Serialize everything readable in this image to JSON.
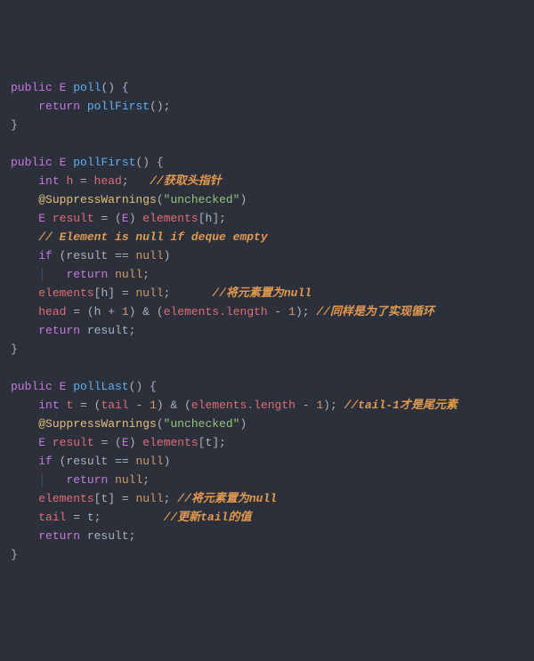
{
  "code": {
    "poll": {
      "kw_public": "public",
      "typ": "E",
      "name": "poll",
      "paren": "() {",
      "ret": "return",
      "call": "pollFirst",
      "after": "();",
      "close": "}"
    },
    "pf": {
      "kw_public": "public",
      "typ": "E",
      "name": "pollFirst",
      "paren": "() {",
      "l1_int": "int",
      "l1_h": "h",
      "l1_eq": " = ",
      "l1_head": "head",
      "l1_semi": ";   ",
      "l1_com": "//获取头指针",
      "l2_ann": "@SuppressWarnings",
      "l2_paren": "(",
      "l2_str": "\"unchecked\"",
      "l2_close": ")",
      "l3_E": "E",
      "l3_res": "result",
      "l3_eq": " = (",
      "l3_E2": "E",
      "l3_close": ") ",
      "l3_elem": "elements",
      "l3_br": "[h];",
      "l4_com": "// Element is null if deque empty",
      "l5_if": "if",
      "l5_cond": " (result == ",
      "l5_null": "null",
      "l5_close": ")",
      "l6_ret": "return",
      "l6_null": "null",
      "l6_semi": ";",
      "l7_elem": "elements",
      "l7_assign": "[h] = ",
      "l7_null": "null",
      "l7_semi": ";      ",
      "l7_com": "//将元素置为null",
      "l8_head": "head",
      "l8_eq": " = (h + ",
      "l8_1": "1",
      "l8_mid": ") & (",
      "l8_elem2": "elements",
      "l8_len": ".length",
      "l8_min": " - ",
      "l8_1b": "1",
      "l8_close": "); ",
      "l8_com": "//同样是为了实现循环",
      "l9_ret": "return",
      "l9_res": " result;",
      "close": "}"
    },
    "pl": {
      "kw_public": "public",
      "typ": "E",
      "name": "pollLast",
      "paren": "() {",
      "l1_int": "int",
      "l1_t": "t",
      "l1_eq": " = (",
      "l1_tail": "tail",
      "l1_min": " - ",
      "l1_1": "1",
      "l1_mid": ") & (",
      "l1_elem": "elements",
      "l1_len": ".length",
      "l1_min2": " - ",
      "l1_1b": "1",
      "l1_close": "); ",
      "l1_com": "//tail-1才是尾元素",
      "l2_ann": "@SuppressWarnings",
      "l2_paren": "(",
      "l2_str": "\"unchecked\"",
      "l2_close": ")",
      "l3_E": "E",
      "l3_res": "result",
      "l3_eq": " = (",
      "l3_E2": "E",
      "l3_close": ") ",
      "l3_elem": "elements",
      "l3_br": "[t];",
      "l4_if": "if",
      "l4_cond": " (result == ",
      "l4_null": "null",
      "l4_close": ")",
      "l5_ret": "return",
      "l5_null": "null",
      "l5_semi": ";",
      "l6_elem": "elements",
      "l6_assign": "[t] = ",
      "l6_null": "null",
      "l6_semi": "; ",
      "l6_com": "//将元素置为null",
      "l7_tail": "tail",
      "l7_eq": " = t;         ",
      "l7_com": "//更新tail的值",
      "l8_ret": "return",
      "l8_res": " result;",
      "close": "}"
    }
  }
}
